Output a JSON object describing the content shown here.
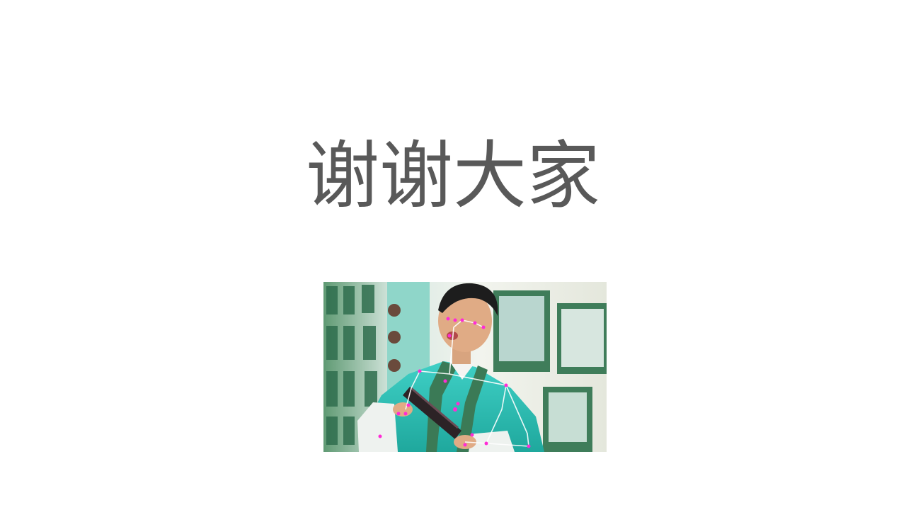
{
  "slide": {
    "title": "谢谢大家"
  },
  "photo": {
    "description_icon": "person-pose-photo",
    "colors": {
      "robe": "#2fbfb4",
      "background_wall": "#e9f0ea",
      "frames": "#3f7d5a",
      "keypoints": "#ff2bd6",
      "skeleton": "#ffffff"
    }
  }
}
